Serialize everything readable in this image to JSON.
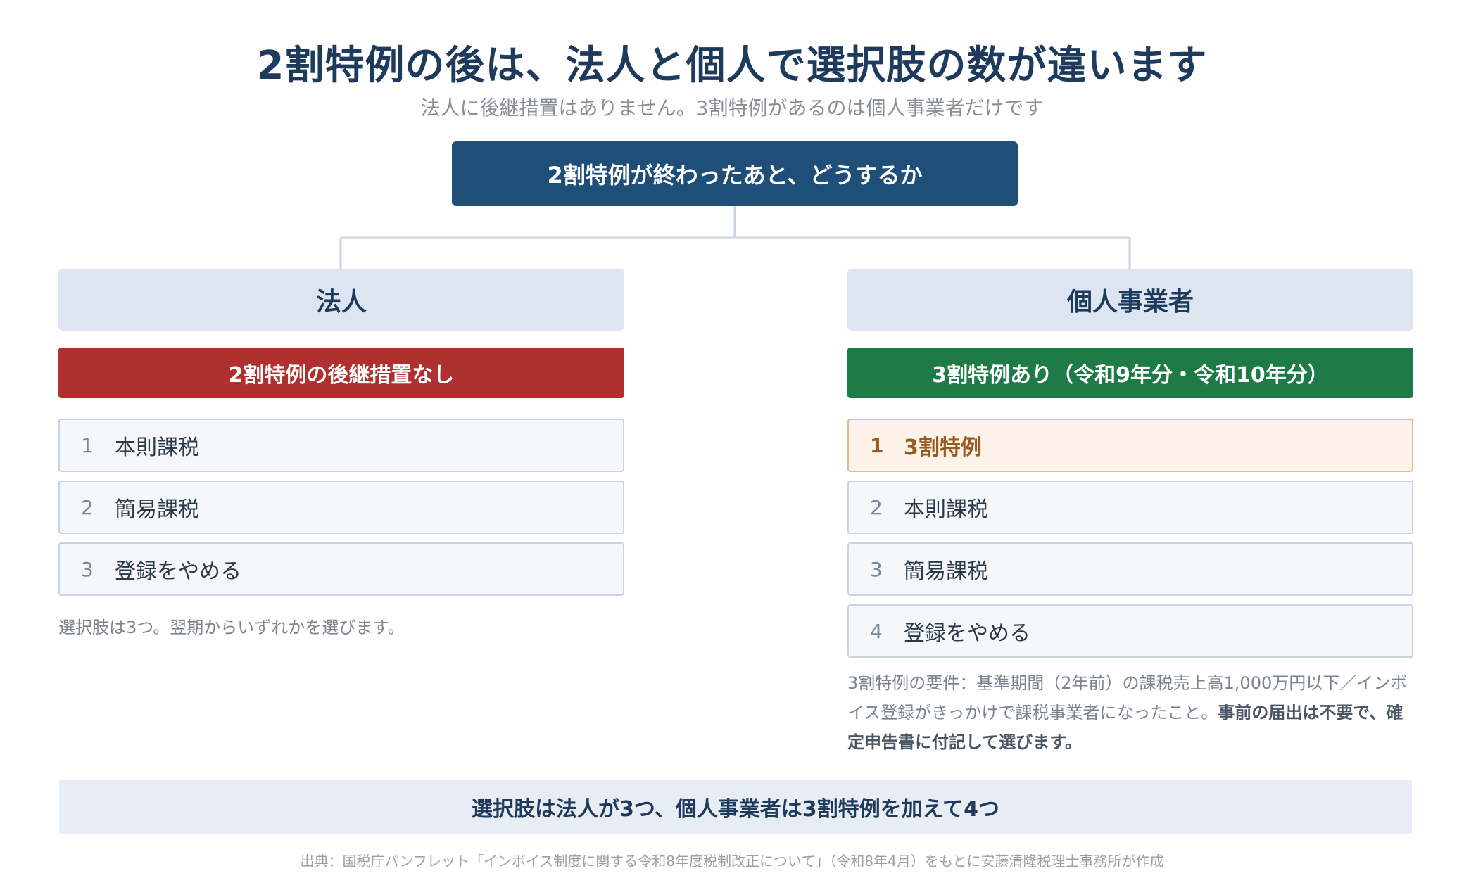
{
  "title": "2割特例の後は、法人と個人で選択肢の数が違います",
  "subtitle": "法人に後継措置はありません。3割特例があるのは個人事業者だけです",
  "root": "2割特例が終わったあと、どうするか",
  "left": {
    "header": "法人",
    "banner": "2割特例の後継措置なし",
    "options": [
      {
        "num": "1",
        "label": "本則課税"
      },
      {
        "num": "2",
        "label": "簡易課税"
      },
      {
        "num": "3",
        "label": "登録をやめる"
      }
    ],
    "note": "選択肢は3つ。翌期からいずれかを選びます。"
  },
  "right": {
    "header": "個人事業者",
    "banner": "3割特例あり（令和9年分・令和10年分）",
    "options": [
      {
        "num": "1",
        "label": "3割特例"
      },
      {
        "num": "2",
        "label": "本則課税"
      },
      {
        "num": "3",
        "label": "簡易課税"
      },
      {
        "num": "4",
        "label": "登録をやめる"
      }
    ],
    "note_plain": "3割特例の要件：基準期間（2年前）の課税売上高1,000万円以下／インボイス登録がきっかけで課税事業者になったこと。",
    "note_bold": "事前の届出は不要で、確定申告書に付記して選びます。"
  },
  "summary": "選択肢は法人が3つ、個人事業者は3割特例を加えて4つ",
  "source": "出典：国税庁パンフレット「インボイス制度に関する令和8年度税制改正について」（令和8年4月）をもとに安藤清隆税理士事務所が作成",
  "colors": {
    "navy": "#1f4e79",
    "red": "#b03030",
    "green": "#1e7a46",
    "highlight_bg": "#fdf3e8",
    "highlight_border": "#e8b887"
  }
}
